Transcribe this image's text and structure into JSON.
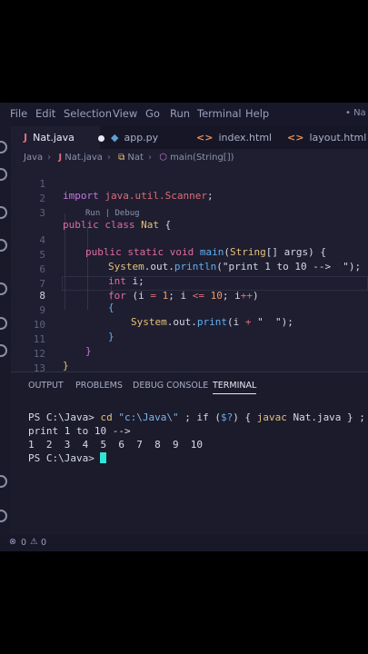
{
  "menu": [
    "File",
    "Edit",
    "Selection",
    "View",
    "Go",
    "Run",
    "Terminal",
    "Help"
  ],
  "window_title": "• Na",
  "tabs": [
    {
      "icon": "J",
      "label": "Nat.java",
      "icon_color": "#e06c75"
    },
    {
      "icon": "◆",
      "label": "app.py",
      "icon_color": "#5aa0d8"
    },
    {
      "icon": "<>",
      "label": "index.html",
      "icon_color": "#e8925a"
    },
    {
      "icon": "<>",
      "label": "layout.html",
      "icon_color": "#e8925a"
    }
  ],
  "breadcrumb": [
    "Java",
    "Nat.java",
    "Nat",
    "main(String[])"
  ],
  "breadcrumb_icons": {
    "java": "J",
    "class": "⧉",
    "method": "⬡"
  },
  "codelens": "Run | Debug",
  "line_numbers": [
    "1",
    "2",
    "3",
    "4",
    "5",
    "6",
    "7",
    "8",
    "9",
    "10",
    "11",
    "12",
    "13"
  ],
  "code": {
    "l1": [
      "import ",
      "java.util.Scanner",
      ";"
    ],
    "l3": [
      "public class ",
      "Nat",
      " {"
    ],
    "l4": [
      "public static void ",
      "main",
      "(",
      "String",
      "[] args) {"
    ],
    "l5": [
      "System",
      ".out.",
      "println",
      "(\"print 1 to 10 -->  \");"
    ],
    "l6": [
      "int",
      " i;"
    ],
    "l7": [
      "for",
      " (i ",
      "=",
      " ",
      "1",
      "; i ",
      "<=",
      " ",
      "10",
      "; i",
      "++",
      ")"
    ],
    "l8": "{",
    "l9": [
      "System",
      ".out.",
      "print",
      "(i ",
      "+",
      " \"  \");"
    ],
    "l10": "}",
    "l11": "}",
    "l12": "}"
  },
  "panel_tabs": [
    "OUTPUT",
    "PROBLEMS",
    "DEBUG CONSOLE",
    "TERMINAL"
  ],
  "terminal": {
    "line1_prompt": "PS C:\\Java> ",
    "line1_cd": "cd",
    "line1_path": " \"c:\\Java\\\"",
    "line1_mid": " ; if (",
    "line1_var": "$?",
    "line1_rest": ") { ",
    "line1_javac": "javac",
    "line1_tail": " Nat.java } ; if ($?",
    "line2": "print 1 to 10 -->",
    "line3": "1  2  3  4  5  6  7  8  9  10",
    "line4": "PS C:\\Java> "
  },
  "status": {
    "errors": "0",
    "warnings": "0"
  },
  "colors": {
    "background": "#1e1e30",
    "accent_cursor": "#2ee6d6",
    "keyword": "#c678dd"
  }
}
